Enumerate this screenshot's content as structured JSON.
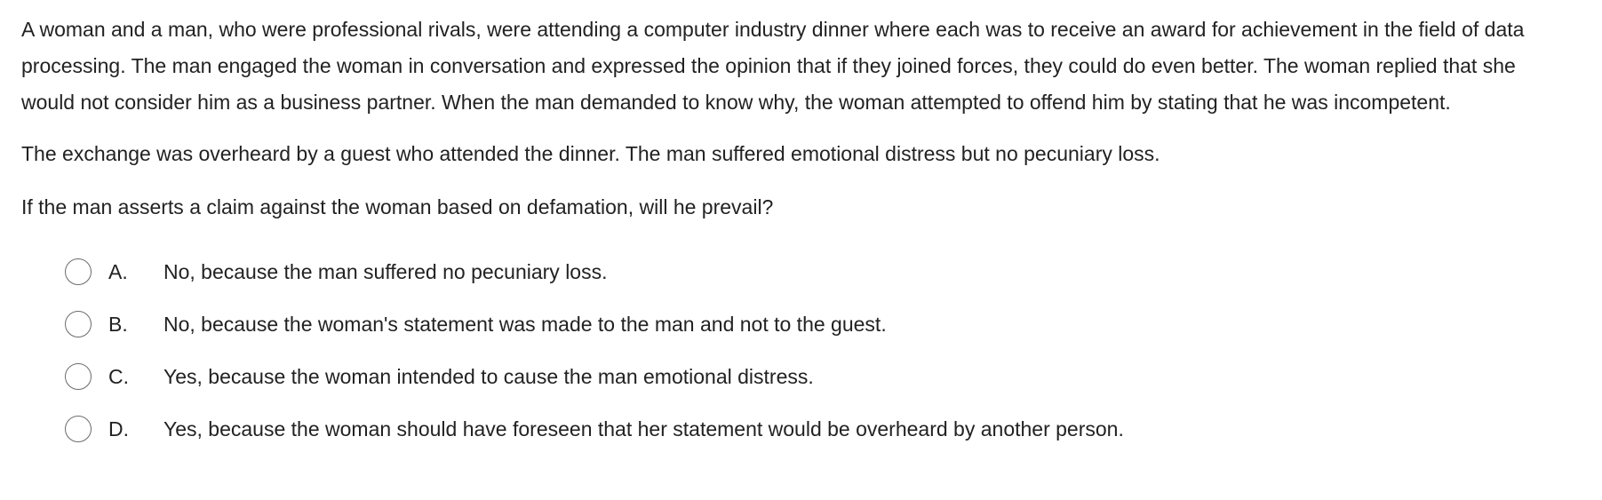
{
  "question": {
    "paragraphs": [
      "A woman and a man, who were professional rivals, were attending a computer industry dinner where each was to receive an award for achievement in the field of data processing.  The man engaged the woman in conversation and expressed the opinion that if they joined forces, they could do even better.  The woman replied that she would not consider him as a business partner.  When the man demanded to know why, the woman attempted to offend him by stating that he was incompetent.",
      "The exchange was overheard by a guest who attended the dinner.  The man suffered emotional distress but no pecuniary loss.",
      "If the man asserts a claim against the woman based on defamation, will he prevail?"
    ],
    "choices": [
      {
        "letter": "A.",
        "text": "No, because the man suffered no pecuniary loss."
      },
      {
        "letter": "B.",
        "text": "No, because the woman's statement was made to the man and not to the guest."
      },
      {
        "letter": "C.",
        "text": "Yes, because the woman intended to cause the man emotional distress."
      },
      {
        "letter": "D.",
        "text": "Yes, because the woman should have foreseen that her statement would be overheard by another person."
      }
    ],
    "selected_choice": null
  },
  "colors": {
    "text": "#222222",
    "radio_border": "#6b6b6b",
    "background": "#ffffff"
  }
}
